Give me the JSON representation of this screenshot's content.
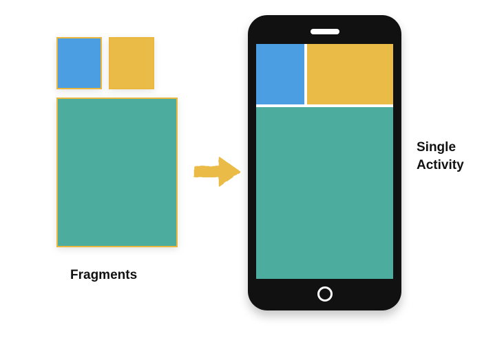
{
  "labels": {
    "fragments": "Fragments",
    "activity_line1": "Single",
    "activity_line2": "Activity"
  },
  "colors": {
    "blue": "#4c9ee3",
    "yellow": "#eabb47",
    "teal": "#4cac9d",
    "phone_body": "#111112"
  },
  "icons": {
    "arrow": "arrow-right-icon"
  }
}
